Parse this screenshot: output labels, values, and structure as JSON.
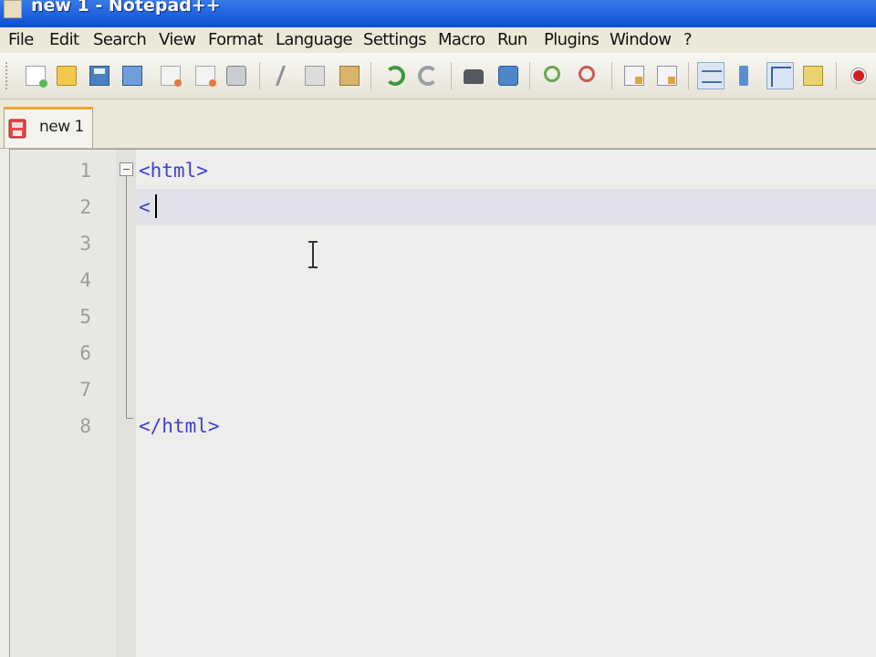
{
  "window": {
    "title": "new 1 - Notepad++"
  },
  "menu": {
    "items": [
      "File",
      "Edit",
      "Search",
      "View",
      "Format",
      "Language",
      "Settings",
      "Macro",
      "Run",
      "Plugins",
      "Window",
      "?"
    ]
  },
  "toolbar": {
    "buttons": [
      "new-file-icon",
      "open-file-icon",
      "save-icon",
      "save-all-icon",
      "close-icon",
      "close-all-icon",
      "print-icon",
      "cut-icon",
      "copy-icon",
      "paste-icon",
      "undo-icon",
      "redo-icon",
      "find-icon",
      "replace-icon",
      "zoom-in-icon",
      "zoom-out-icon",
      "sync-vertical-icon",
      "sync-horizontal-icon",
      "word-wrap-icon",
      "show-all-characters-icon",
      "indent-guide-icon",
      "user-language-icon",
      "record-macro-icon"
    ]
  },
  "tabs": [
    {
      "label": "new 1",
      "icon": "unsaved-file-icon"
    }
  ],
  "editor": {
    "line_numbers": [
      "1",
      "2",
      "3",
      "4",
      "5",
      "6",
      "7",
      "8"
    ],
    "lines": [
      "<html>",
      "<",
      "",
      "",
      "",
      "",
      "",
      "</html>"
    ],
    "current_line": 2
  },
  "colors": {
    "titlebar": "#0a4fd6",
    "tag_text": "#4040d0",
    "active_tab_accent": "#f0a43a",
    "line_highlight": "#e1e2e9"
  }
}
